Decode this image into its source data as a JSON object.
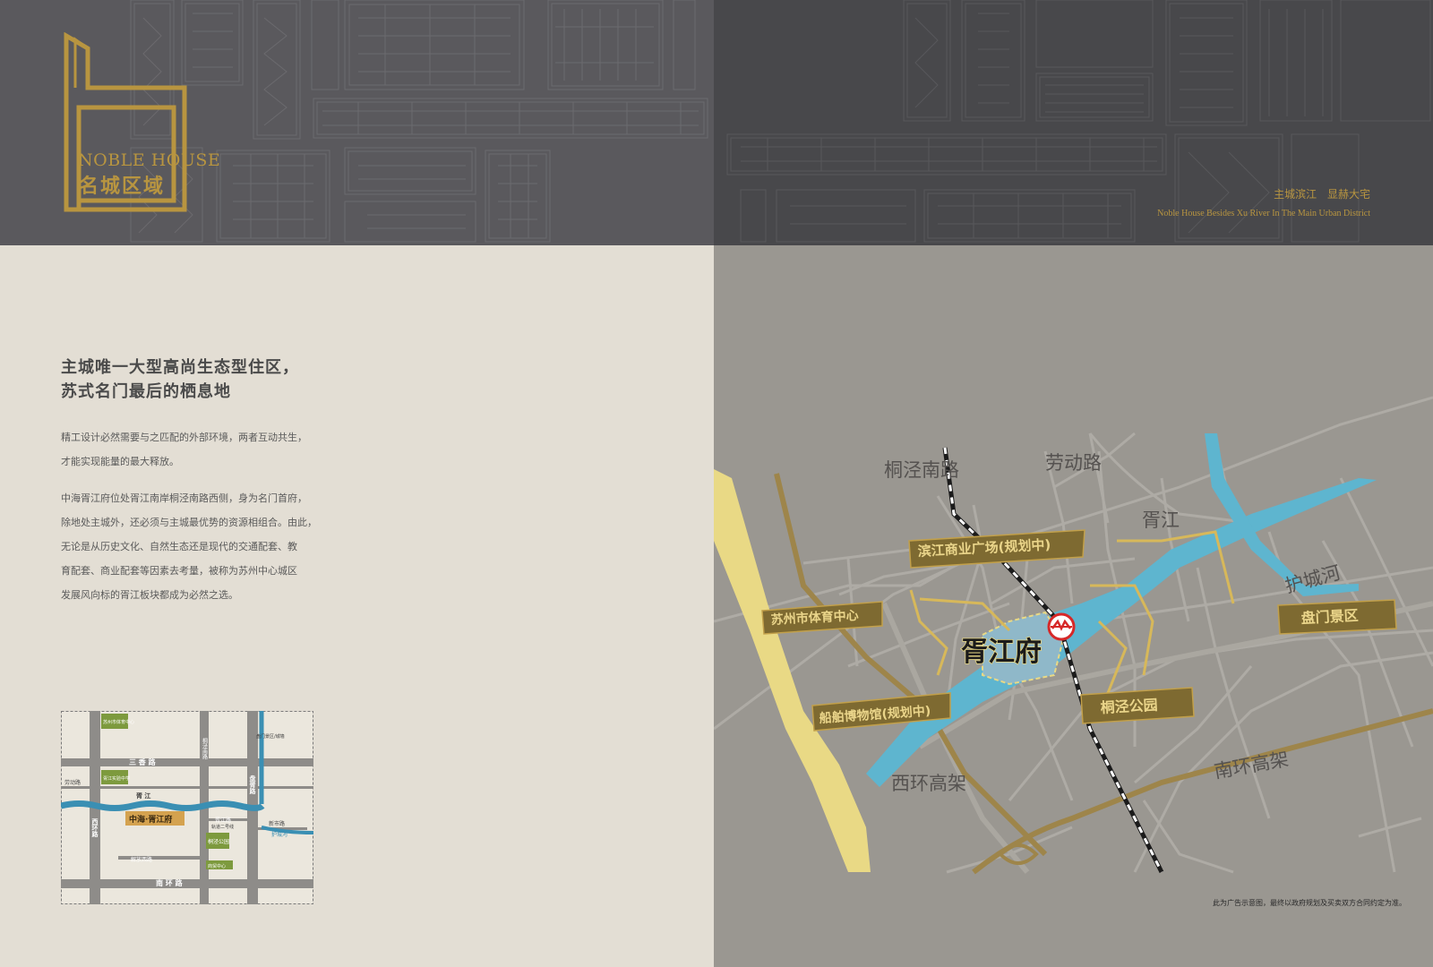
{
  "header": {
    "logo_en": "NOBLE HOUSE",
    "logo_cn": "名城区域",
    "tagline_cn": "主城滨江 显赫大宅",
    "tagline_en": "Noble House Besides Xu River In The Main Urban District"
  },
  "intro": {
    "headline": [
      "主城唯一大型高尚生态型住区，",
      "苏式名门最后的栖息地"
    ],
    "paragraph1": [
      "精工设计必然需要与之匹配的外部环境，两者互动共生，",
      "才能实现能量的最大释放。"
    ],
    "paragraph2": [
      "中海胥江府位处胥江南岸桐泾南路西侧，身为名门首府，",
      "除地处主城外，还必须与主城最优势的资源相组合。由此，",
      "无论是从历史文化、自然生态还是现代的交通配套、教",
      "育配套、商业配套等因素去考量，被称为苏州中心城区",
      "发展风向标的胥江板块都成为必然之选。"
    ]
  },
  "mini_map": {
    "roads": {
      "sanxiang": "三 香 路",
      "laodong": "劳动路",
      "xihuan": "西环路",
      "tongjing": "桐泾南路",
      "panxu": "盘胥路",
      "xujiang_road": "胥江路",
      "xinshi": "新市路",
      "jiefang": "解放西路",
      "nanhuan": "南 环 路"
    },
    "river": "胥 江",
    "moat": "护城河",
    "project": "中海·胥江府",
    "pois": {
      "stadium": "苏州市体育中心",
      "school": "胥江实验中学",
      "panmen": "盘门景区/城墙",
      "tongjing_park": "桐泾公园",
      "commerce": "商贸中心",
      "metro": "轨道二号线"
    }
  },
  "main_map": {
    "roads": {
      "tongjing_nan": "桐泾南路",
      "laodong": "劳动路",
      "xihuan": "西环高架",
      "nanhuan": "南环高架"
    },
    "water": {
      "xujiang": "胥江",
      "moat": "护城河"
    },
    "project": "胥江府",
    "pois": {
      "binjiang": "滨江商业广场(规划中)",
      "stadium": "苏州市体育中心",
      "museum": "船舶博物馆(规划中)",
      "tongjing_park": "桐泾公园",
      "panmen": "盘门景区"
    },
    "colors": {
      "river": "#5eb5cf",
      "gold": "#b89540",
      "road": "#aeaba5",
      "canal": "#e9d985"
    }
  },
  "disclaimer": "此为广告示意图，最终以政府规划及买卖双方合同约定为准。"
}
